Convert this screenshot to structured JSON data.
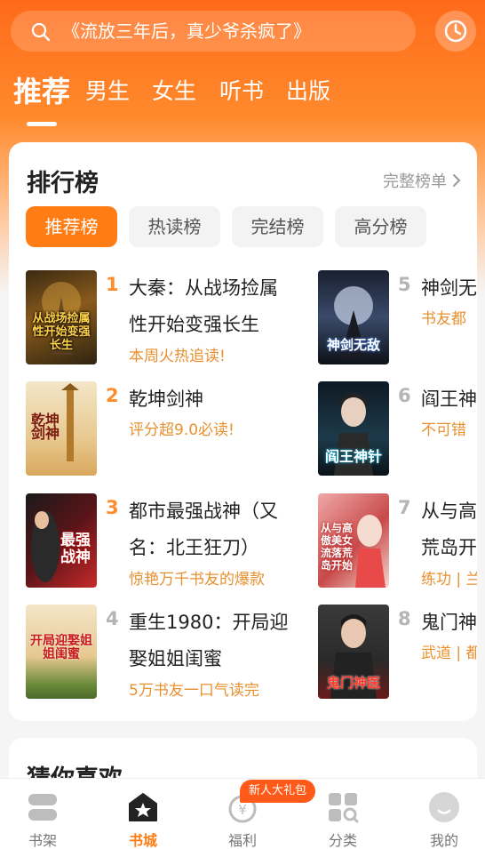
{
  "search": {
    "text": "《流放三年后，真少爷杀疯了》"
  },
  "icons": {
    "search": "search-icon",
    "history": "clock-icon",
    "chevron": "chevron-right-icon"
  },
  "tabs": [
    {
      "label": "推荐",
      "active": true
    },
    {
      "label": "男生",
      "active": false
    },
    {
      "label": "女生",
      "active": false
    },
    {
      "label": "听书",
      "active": false
    },
    {
      "label": "出版",
      "active": false
    }
  ],
  "ranking": {
    "title": "排行榜",
    "full_list": "完整榜单",
    "chips": [
      {
        "label": "推荐榜",
        "active": true
      },
      {
        "label": "热读榜",
        "active": false
      },
      {
        "label": "完结榜",
        "active": false
      },
      {
        "label": "高分榜",
        "active": false
      }
    ],
    "books": [
      {
        "rank": "1",
        "name": "大秦：从战场捡属性开始变强长生",
        "desc": "本周火热追读!",
        "cover_text": "从战场捡属性开始变强长生"
      },
      {
        "rank": "2",
        "name": "乾坤剑神",
        "desc": "评分超9.0必读!",
        "cover_text": "乾坤剑神"
      },
      {
        "rank": "3",
        "name": "都市最强战神（又名：北王狂刀）",
        "desc": "惊艳万千书友的爆款",
        "cover_text": "最强战神"
      },
      {
        "rank": "4",
        "name": "重生1980：开局迎娶姐姐闺蜜",
        "desc": "5万书友一口气读完",
        "cover_text": "开局迎娶姐姐闺蜜"
      },
      {
        "rank": "5",
        "name": "神剑无",
        "desc": "书友都",
        "cover_text": "神剑无敌"
      },
      {
        "rank": "6",
        "name": "阎王神",
        "desc": "不可错",
        "cover_text": "阎王神针"
      },
      {
        "rank": "7",
        "name": "从与高",
        "name2": "荒岛开",
        "desc": "练功 | 兰",
        "cover_text": "从与高傲美女流落荒岛开始"
      },
      {
        "rank": "8",
        "name": "鬼门神",
        "desc": "武道 | 都",
        "cover_text": "鬼门神医"
      }
    ]
  },
  "guess": {
    "title": "猜你喜欢"
  },
  "bottom_nav": {
    "gift_badge": "新人大礼包",
    "items": [
      {
        "label": "书架",
        "active": false
      },
      {
        "label": "书城",
        "active": true
      },
      {
        "label": "福利",
        "active": false
      },
      {
        "label": "分类",
        "active": false
      },
      {
        "label": "我的",
        "active": false
      }
    ]
  },
  "colors": {
    "accent": "#ff7d14",
    "desc": "#e8902f",
    "rank_top": "#ff8c2a",
    "rank_low": "#b5b5b5"
  }
}
